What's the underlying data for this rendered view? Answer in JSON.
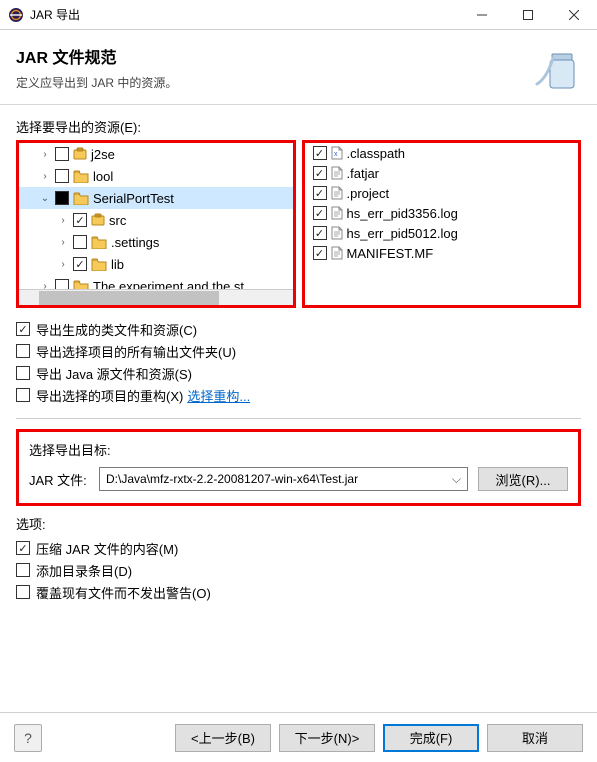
{
  "window": {
    "title": "JAR 导出"
  },
  "header": {
    "title": "JAR 文件规范",
    "desc": "定义应导出到 JAR 中的资源。"
  },
  "resourcesLabel": "选择要导出的资源(E):",
  "tree": [
    {
      "label": "j2se",
      "depth": 0,
      "expanded": false,
      "check": "none",
      "sel": false,
      "icon": "pkg"
    },
    {
      "label": "lool",
      "depth": 0,
      "expanded": false,
      "check": "none",
      "sel": false,
      "icon": "folder"
    },
    {
      "label": "SerialPortTest",
      "depth": 0,
      "expanded": true,
      "check": "full",
      "sel": true,
      "icon": "folder"
    },
    {
      "label": "src",
      "depth": 1,
      "expanded": false,
      "check": "checked",
      "sel": false,
      "icon": "pkg"
    },
    {
      "label": ".settings",
      "depth": 1,
      "expanded": false,
      "check": "none",
      "sel": false,
      "icon": "folder"
    },
    {
      "label": "lib",
      "depth": 1,
      "expanded": false,
      "check": "checked",
      "sel": false,
      "icon": "folder"
    },
    {
      "label": "The experiment and the st",
      "depth": 0,
      "expanded": false,
      "check": "none",
      "sel": false,
      "icon": "folder"
    }
  ],
  "files": [
    {
      "label": ".classpath",
      "checked": true,
      "ico": "x"
    },
    {
      "label": ".fatjar",
      "checked": true,
      "ico": "txt"
    },
    {
      "label": ".project",
      "checked": true,
      "ico": "txt"
    },
    {
      "label": "hs_err_pid3356.log",
      "checked": true,
      "ico": "txt"
    },
    {
      "label": "hs_err_pid5012.log",
      "checked": true,
      "ico": "txt"
    },
    {
      "label": "MANIFEST.MF",
      "checked": true,
      "ico": "txt"
    }
  ],
  "exportOpts": [
    {
      "label": "导出生成的类文件和资源(C)",
      "checked": true
    },
    {
      "label": "导出选择项目的所有输出文件夹(U)",
      "checked": false
    },
    {
      "label": "导出 Java 源文件和资源(S)",
      "checked": false
    },
    {
      "label": "导出选择的项目的重构(X)",
      "checked": false,
      "link": "选择重构..."
    }
  ],
  "dest": {
    "label": "选择导出目标:",
    "fieldLabel": "JAR 文件:",
    "value": "D:\\Java\\mfz-rxtx-2.2-20081207-win-x64\\Test.jar",
    "browse": "浏览(R)..."
  },
  "optsLabel": "选项:",
  "opts": [
    {
      "label": "压缩 JAR 文件的内容(M)",
      "checked": true
    },
    {
      "label": "添加目录条目(D)",
      "checked": false
    },
    {
      "label": "覆盖现有文件而不发出警告(O)",
      "checked": false
    }
  ],
  "buttons": {
    "back": "<上一步(B)",
    "next": "下一步(N)>",
    "finish": "完成(F)",
    "cancel": "取消"
  }
}
